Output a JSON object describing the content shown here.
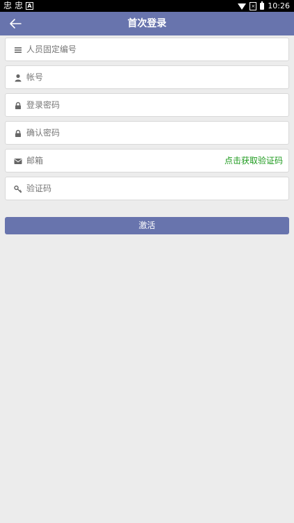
{
  "status_bar": {
    "left_glyphs": [
      "忠",
      "忠",
      "A"
    ],
    "time": "10:26"
  },
  "header": {
    "back_icon": "back-arrow-icon",
    "title": "首次登录"
  },
  "form": {
    "fields": [
      {
        "placeholder": "人员固定编号",
        "icon": "menu-icon"
      },
      {
        "placeholder": "帐号",
        "icon": "user-icon"
      },
      {
        "placeholder": "登录密码",
        "icon": "lock-icon"
      },
      {
        "placeholder": "确认密码",
        "icon": "lock-icon"
      },
      {
        "placeholder": "邮箱",
        "icon": "envelope-icon"
      },
      {
        "placeholder": "验证码",
        "icon": "key-icon"
      }
    ],
    "get_code_label": "点击获取验证码",
    "submit_label": "激活"
  },
  "colors": {
    "primary": "#6874ad",
    "link_green": "#1d9a1d",
    "background": "#ececec"
  }
}
